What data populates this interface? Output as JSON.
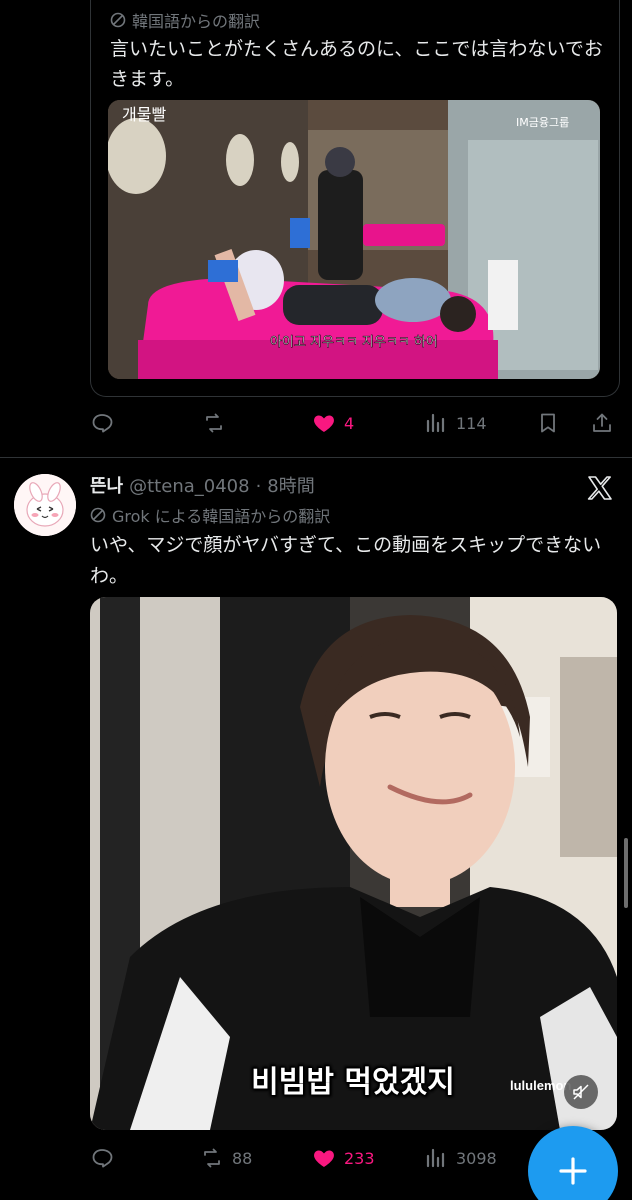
{
  "tweet1": {
    "translation_label": "韓国語からの翻訳",
    "text": "言いたいことがたくさんあるのに、ここでは言わないでおきます。",
    "media": {
      "logo_text": "개물빨",
      "watermark": "IM금융그룹",
      "subtitle": "아이고 지우ㅋㅋ 지우ㅋㅋ 하어"
    },
    "actions": {
      "reply_count": "",
      "retweet_count": "",
      "like_count": "4",
      "views_count": "114"
    }
  },
  "tweet2": {
    "display_name": "뜬나",
    "handle": "@ttena_0408",
    "separator": "·",
    "time": "8時間",
    "translation_label": "Grok による韓国語からの翻訳",
    "text": "いや、マジで顔がヤバすぎて、この動画をスキップできないわ。",
    "media": {
      "subtitle": "비빔밥 먹었겠지",
      "brand_text": "lululemon"
    },
    "actions": {
      "reply_count": "",
      "retweet_count": "88",
      "like_count": "233",
      "views_count": "3098"
    }
  },
  "colors": {
    "background": "#000000",
    "text": "#e7e9ea",
    "muted": "#71767b",
    "like": "#f91880",
    "accent": "#1d9bf0",
    "border": "#2f3336"
  },
  "icons": [
    "translate-icon",
    "reply-icon",
    "retweet-icon",
    "heart-icon",
    "views-icon",
    "bookmark-icon",
    "share-icon",
    "x-logo-icon",
    "mute-icon",
    "compose-plus-icon"
  ]
}
